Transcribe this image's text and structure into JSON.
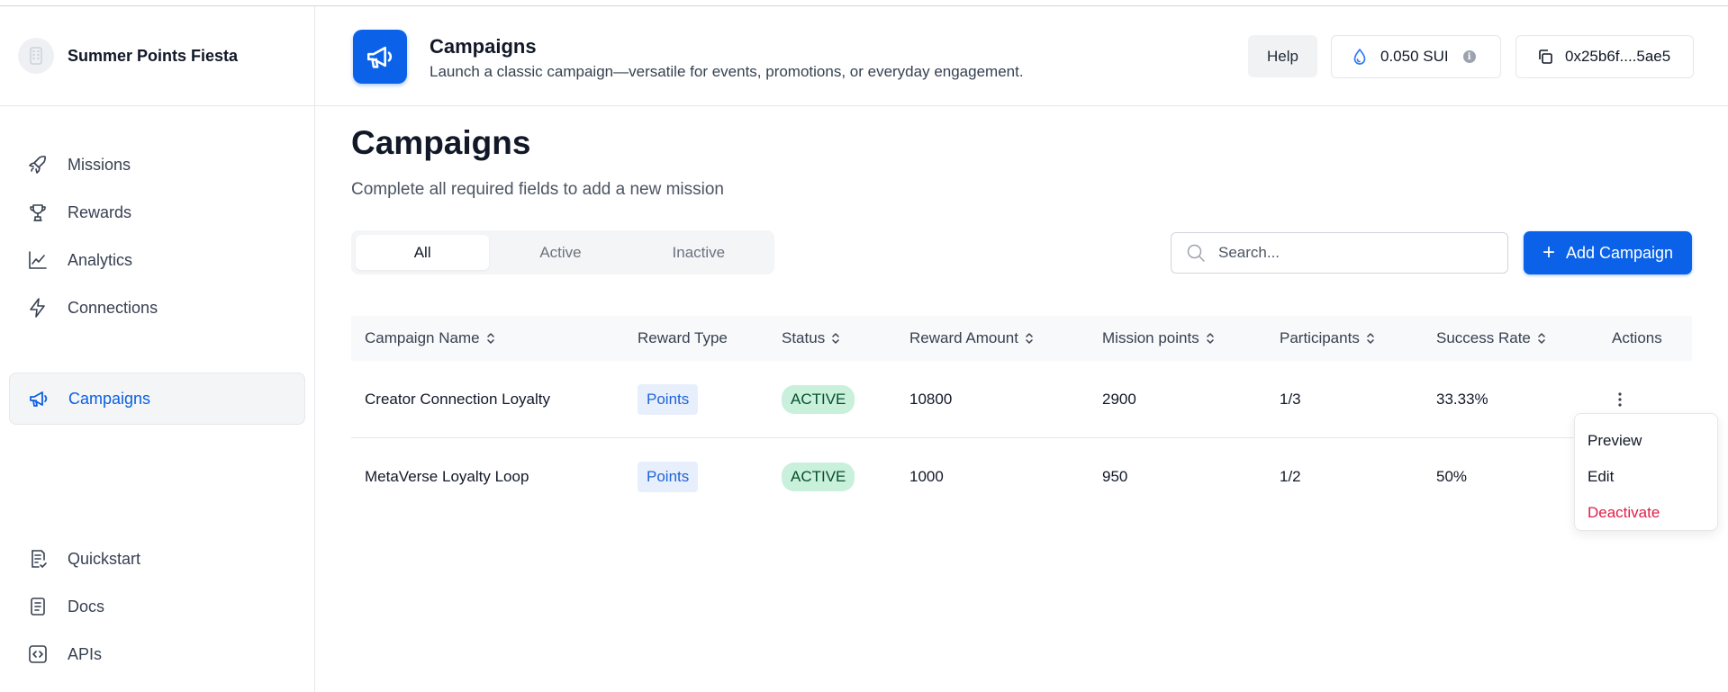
{
  "brand": {
    "name": "Summer Points Fiesta"
  },
  "sidebar": {
    "items": [
      {
        "label": "Missions",
        "icon": "rocket-icon"
      },
      {
        "label": "Rewards",
        "icon": "trophy-icon"
      },
      {
        "label": "Analytics",
        "icon": "line-chart-icon"
      },
      {
        "label": "Connections",
        "icon": "lightning-icon"
      },
      {
        "label": "Campaigns",
        "icon": "megaphone-icon",
        "active": true
      }
    ],
    "bottom_items": [
      {
        "label": "Quickstart",
        "icon": "checklist-icon"
      },
      {
        "label": "Docs",
        "icon": "document-icon"
      },
      {
        "label": "APIs",
        "icon": "code-icon"
      }
    ]
  },
  "header": {
    "title": "Campaigns",
    "subtitle": "Launch a classic campaign—versatile for events, promotions, or everyday engagement.",
    "help_label": "Help",
    "balance": "0.050 SUI",
    "wallet": "0x25b6f....5ae5"
  },
  "main": {
    "title": "Campaigns",
    "subtitle": "Complete all required fields to add a new mission",
    "tabs": [
      {
        "label": "All",
        "active": true
      },
      {
        "label": "Active"
      },
      {
        "label": "Inactive"
      }
    ],
    "search_placeholder": "Search...",
    "add_button": "Add Campaign"
  },
  "table": {
    "columns": [
      "Campaign Name",
      "Reward Type",
      "Status",
      "Reward Amount",
      "Mission points",
      "Participants",
      "Success Rate",
      "Actions"
    ],
    "rows": [
      {
        "name": "Creator Connection Loyalty",
        "reward_type": "Points",
        "status": "ACTIVE",
        "reward_amount": "10800",
        "mission_points": "2900",
        "participants": "1/3",
        "success_rate": "33.33%"
      },
      {
        "name": "MetaVerse Loyalty Loop",
        "reward_type": "Points",
        "status": "ACTIVE",
        "reward_amount": "1000",
        "mission_points": "950",
        "participants": "1/2",
        "success_rate": "50%"
      }
    ]
  },
  "action_menu": {
    "items": [
      "Preview",
      "Edit",
      "Deactivate"
    ]
  },
  "colors": {
    "accent": "#0b62e8",
    "active_nav_text": "#0b5fe0",
    "status_active_bg": "#c9f0da",
    "danger": "#e11d48"
  }
}
